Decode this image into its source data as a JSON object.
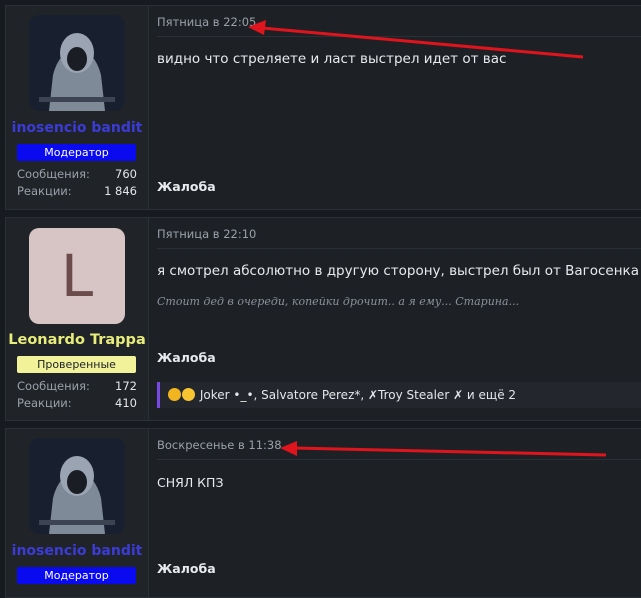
{
  "posts": [
    {
      "user": {
        "name": "inosencio bandit",
        "role": "Модератор",
        "name_color": "#3b3bd6",
        "role_color": "#0a0af0"
      },
      "stats": [
        {
          "label": "Сообщения:",
          "value": "760"
        },
        {
          "label": "Реакции:",
          "value": "1 846"
        }
      ],
      "date": "Пятница в 22:05",
      "message": "видно что стреляете и ласт выстрел идет от вас",
      "action": "Жалоба"
    },
    {
      "user": {
        "name": "Leonardo Trappa",
        "avatar_letter": "L",
        "role": "Проверенные",
        "name_color": "#e8ec7a",
        "role_color": "#f1f29a"
      },
      "stats": [
        {
          "label": "Сообщения:",
          "value": "172"
        },
        {
          "label": "Реакции:",
          "value": "410"
        }
      ],
      "date": "Пятница в 22:10",
      "message": "я смотрел абсолютно в другую сторону, выстрел был от Вагосенка",
      "signature": "Стоит дед в очереди, копейки дрочит.. а я ему... Старина...",
      "action": "Жалоба",
      "reactions": "Joker •_•, Salvatore Perez*, ✗Troy Stealer ✗ и ещё 2"
    },
    {
      "user": {
        "name": "inosencio bandit",
        "role": "Модератор",
        "name_color": "#3b3bd6",
        "role_color": "#0a0af0"
      },
      "date": "Воскресенье в 11:38",
      "message": "СНЯЛ КПЗ",
      "action": "Жалоба"
    }
  ],
  "annotation_color": "#e0141c"
}
